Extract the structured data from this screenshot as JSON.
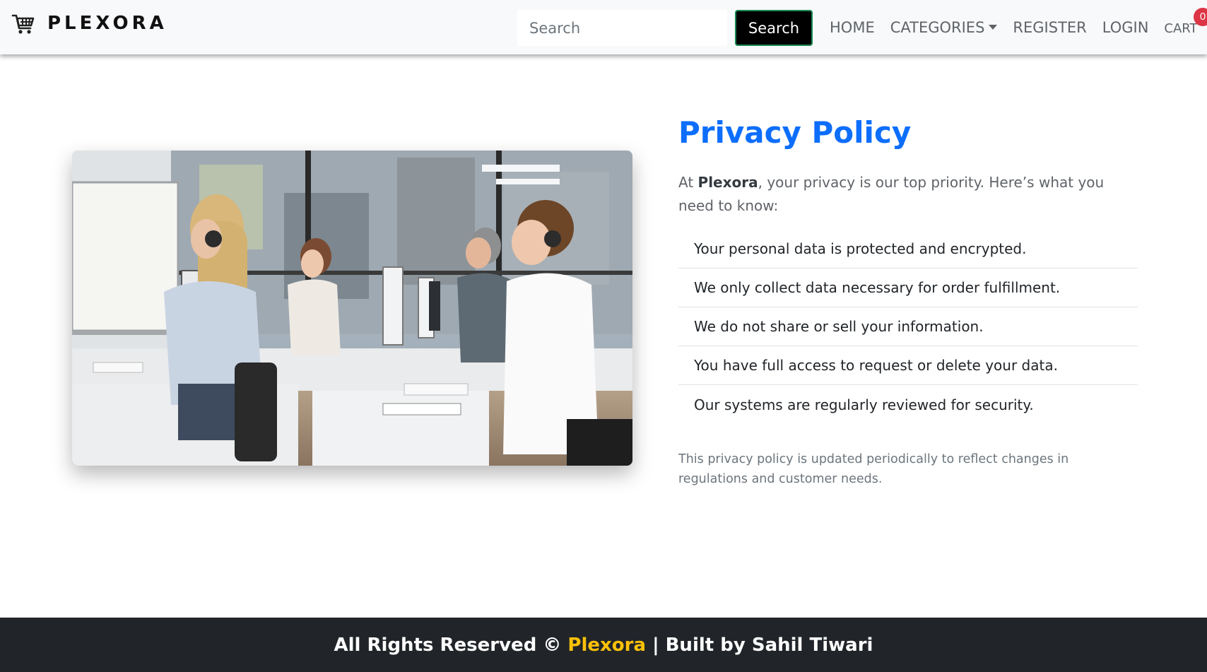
{
  "brand": {
    "name": "PLEXORA",
    "icon": "shopping-cart-icon"
  },
  "search": {
    "placeholder": "Search",
    "button_label": "Search"
  },
  "nav": {
    "home": "HOME",
    "categories": "CATEGORIES",
    "register": "REGISTER",
    "login": "LOGIN",
    "cart": "CART",
    "cart_count": "0"
  },
  "main": {
    "title": "Privacy Policy",
    "intro_prefix": "At ",
    "intro_brand": "Plexora",
    "intro_suffix": ", your privacy is our top priority. Here’s what you need to know:",
    "items": [
      "Your personal data is protected and encrypted.",
      "We only collect data necessary for order fulfillment.",
      "We do not share or sell your information.",
      "You have full access to request or delete your data.",
      "Our systems are regularly reviewed for security."
    ],
    "note": "This privacy policy is updated periodically to reflect changes in regulations and customer needs."
  },
  "footer": {
    "prefix": "All Rights Reserved © ",
    "brand": "Plexora",
    "suffix": " | Built by Sahil Tiwari"
  },
  "colors": {
    "title_blue": "#0d6efd",
    "footer_bg": "#212529",
    "footer_brand": "#ffc107",
    "badge_red": "#dc3545"
  }
}
